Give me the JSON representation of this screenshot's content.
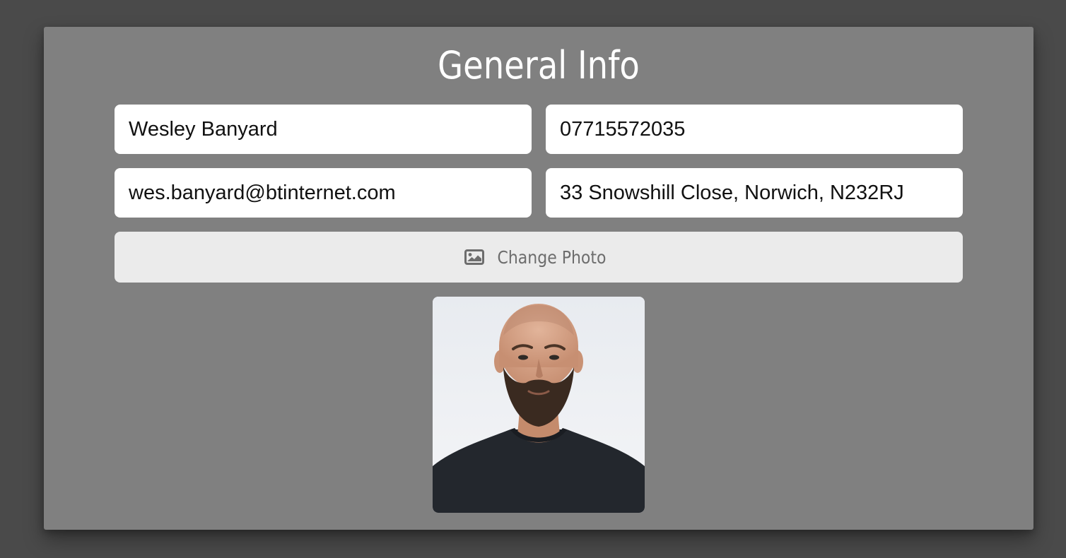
{
  "card": {
    "title": "General Info",
    "fields": {
      "name": "Wesley Banyard",
      "phone": "07715572035",
      "email": "wes.banyard@btinternet.com",
      "address": "33 Snowshill Close, Norwich, N232RJ"
    },
    "change_photo": {
      "icon": "image-icon",
      "label": "Change Photo"
    },
    "photo": {
      "subject": "profile-photo"
    }
  },
  "colors": {
    "page_background": "#4a4a4a",
    "card_background": "#808080",
    "field_background": "#ffffff",
    "button_background": "#ebebeb",
    "button_text": "#6d6d6d",
    "title_text": "#ffffff"
  }
}
